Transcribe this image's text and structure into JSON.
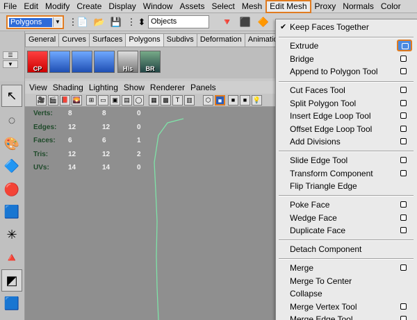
{
  "menubar": {
    "items": [
      "File",
      "Edit",
      "Modify",
      "Create",
      "Display",
      "Window",
      "Assets",
      "Select",
      "Mesh",
      "Edit Mesh",
      "Proxy",
      "Normals",
      "Color"
    ],
    "active": "Edit Mesh"
  },
  "statusline": {
    "mode": "Polygons",
    "object_field": "Objects"
  },
  "shelf": {
    "tabs": [
      "General",
      "Curves",
      "Surfaces",
      "Polygons",
      "Subdivs",
      "Deformation",
      "Animation"
    ],
    "selected_tab": "Polygons",
    "buttons": [
      {
        "label": "CP",
        "icon": "combine-polygons-icon"
      },
      {
        "label": "",
        "icon": "extrude-cube-icon"
      },
      {
        "label": "",
        "icon": "grid-plane-icon"
      },
      {
        "label": "",
        "icon": "subdivided-plane-icon"
      },
      {
        "label": "His",
        "icon": "history-icon"
      },
      {
        "label": "BR",
        "icon": "brush-icon"
      }
    ]
  },
  "panel_menu": [
    "View",
    "Shading",
    "Lighting",
    "Show",
    "Renderer",
    "Panels"
  ],
  "hud": {
    "rows": [
      {
        "label": "Verts:",
        "a": "8",
        "b": "8",
        "c": "0"
      },
      {
        "label": "Edges:",
        "a": "12",
        "b": "12",
        "c": "0"
      },
      {
        "label": "Faces:",
        "a": "6",
        "b": "6",
        "c": "1"
      },
      {
        "label": "Tris:",
        "a": "12",
        "b": "12",
        "c": "2"
      },
      {
        "label": "UVs:",
        "a": "14",
        "b": "14",
        "c": "0"
      }
    ]
  },
  "edit_mesh_menu": {
    "keep_faces_together": {
      "label": "Keep Faces Together",
      "checked": true
    },
    "items": [
      {
        "label": "Extrude",
        "option_box": true,
        "highlight": true
      },
      {
        "label": "Bridge",
        "option_box": true
      },
      {
        "label": "Append to Polygon Tool",
        "option_box": true
      },
      {
        "label": "Cut Faces Tool",
        "option_box": true
      },
      {
        "label": "Split Polygon Tool",
        "option_box": true
      },
      {
        "label": "Insert Edge Loop Tool",
        "option_box": true
      },
      {
        "label": "Offset Edge Loop Tool",
        "option_box": true
      },
      {
        "label": "Add Divisions",
        "option_box": true
      },
      {
        "label": "Slide Edge Tool",
        "option_box": true
      },
      {
        "label": "Transform Component",
        "option_box": true
      },
      {
        "label": "Flip Triangle Edge",
        "option_box": false
      },
      {
        "label": "Poke Face",
        "option_box": true
      },
      {
        "label": "Wedge Face",
        "option_box": true
      },
      {
        "label": "Duplicate Face",
        "option_box": true
      },
      {
        "label": "Detach Component",
        "option_box": false
      },
      {
        "label": "Merge",
        "option_box": true
      },
      {
        "label": "Merge To Center",
        "option_box": false
      },
      {
        "label": "Collapse",
        "option_box": false
      },
      {
        "label": "Merge Vertex Tool",
        "option_box": true
      },
      {
        "label": "Merge Edge Tool",
        "option_box": true
      }
    ]
  },
  "colors": {
    "highlight_border": "#e07b20",
    "selection_blue": "#2f6bd8",
    "viewport_bg": "#8f8f8f",
    "curve": "#7fe3a8"
  }
}
